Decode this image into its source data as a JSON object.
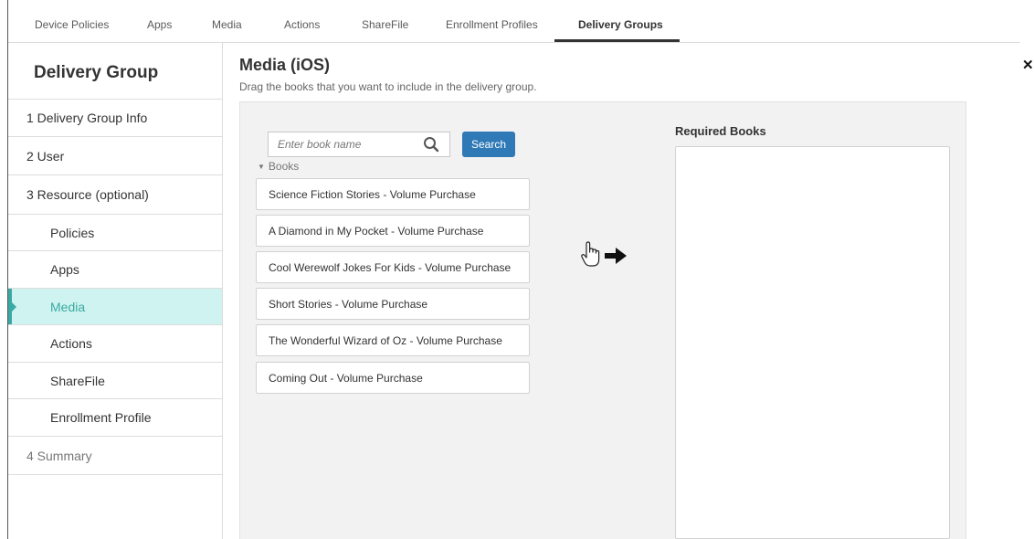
{
  "tabs": [
    {
      "label": "Device Policies"
    },
    {
      "label": "Apps"
    },
    {
      "label": "Media"
    },
    {
      "label": "Actions"
    },
    {
      "label": "ShareFile"
    },
    {
      "label": "Enrollment Profiles"
    },
    {
      "label": "Delivery Groups",
      "active": true
    }
  ],
  "sidebar": {
    "title": "Delivery Group",
    "items": [
      {
        "label": "1  Delivery Group Info"
      },
      {
        "label": "2  User"
      },
      {
        "label": "3  Resource (optional)"
      },
      {
        "label": "Policies"
      },
      {
        "label": "Apps"
      },
      {
        "label": "Media",
        "active": true
      },
      {
        "label": "Actions"
      },
      {
        "label": "ShareFile"
      },
      {
        "label": "Enrollment Profile"
      },
      {
        "label": "4  Summary"
      }
    ]
  },
  "main": {
    "title": "Media (iOS)",
    "subtitle": "Drag the books that you want to include in the delivery group.",
    "search": {
      "placeholder": "Enter book name",
      "value": "",
      "button_label": "Search"
    },
    "books_label": "Books",
    "books": [
      "Science Fiction Stories - Volume Purchase",
      "A Diamond in My Pocket - Volume Purchase",
      "Cool Werewolf Jokes For Kids - Volume Purchase",
      "Short Stories - Volume Purchase",
      "The Wonderful Wizard of Oz - Volume Purchase",
      "Coming Out - Volume Purchase"
    ],
    "required_label": "Required Books"
  },
  "icons": {
    "close": "close-icon",
    "search": "search-icon",
    "drag": "hand-pointer-icon",
    "arrow": "arrow-right-icon",
    "collapse": "triangle-down-icon"
  },
  "colors": {
    "accent": "#3aa9a4",
    "active_bg": "#cff3f0",
    "button": "#2f79b7",
    "panel_bg": "#f2f2f2"
  }
}
